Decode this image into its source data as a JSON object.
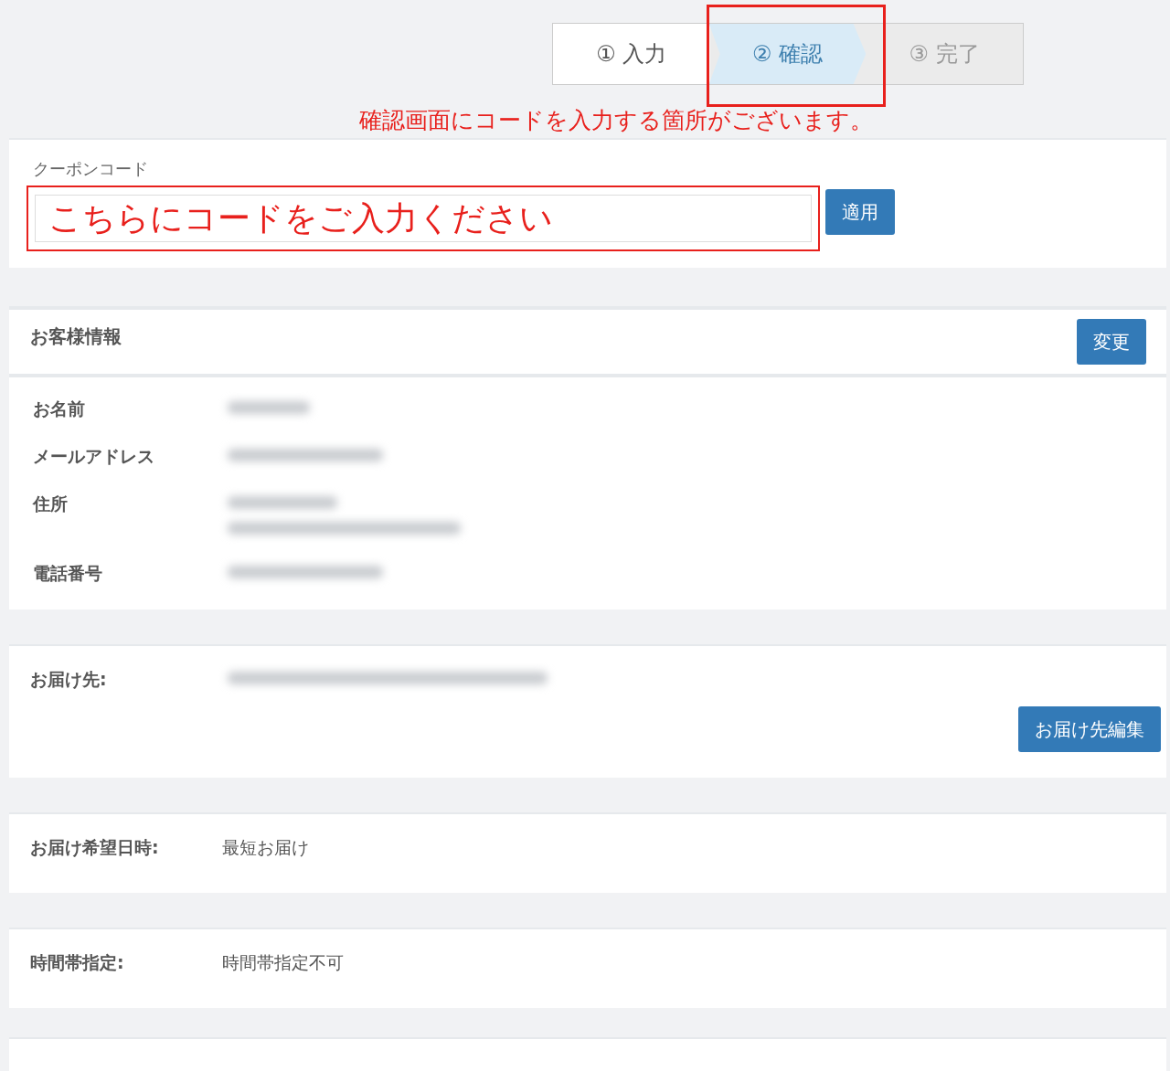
{
  "steps": [
    {
      "label": "① 入力",
      "selected": false,
      "disabled": false
    },
    {
      "label": "② 確認",
      "selected": true,
      "disabled": false
    },
    {
      "label": "③ 完了",
      "selected": false,
      "disabled": true
    }
  ],
  "annotation": {
    "highlight_step": true,
    "note": "確認画面にコードを入力する箇所がございます。",
    "input_text": "こちらにコードをご入力ください"
  },
  "coupon": {
    "label": "クーポンコード",
    "button": "適用"
  },
  "customer": {
    "title": "お客様情報",
    "button": "変更",
    "rows": [
      {
        "label": "お名前",
        "kind": "short"
      },
      {
        "label": "メールアドレス",
        "kind": "medium"
      },
      {
        "label": "住所",
        "kind": "address"
      },
      {
        "label": "電話番号",
        "kind": "medium"
      }
    ]
  },
  "delivery": {
    "label": "お届け先:",
    "kind": "long",
    "button": "お届け先編集"
  },
  "delivery_date": {
    "label": "お届け希望日時:",
    "value": "最短お届け"
  },
  "time_slot": {
    "label": "時間帯指定:",
    "value": "時間帯指定不可"
  }
}
